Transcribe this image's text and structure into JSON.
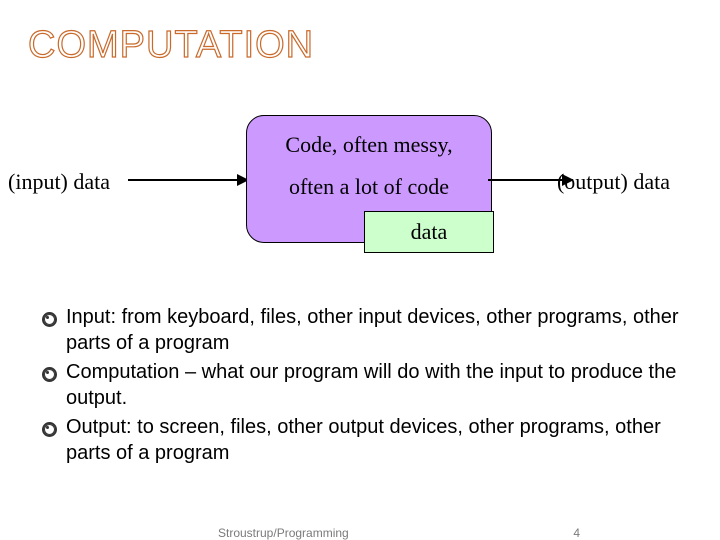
{
  "title": "COMPUTATION",
  "diagram": {
    "input_label": "(input) data",
    "output_label": "(output) data",
    "code_line1": "Code, often messy,",
    "code_line2": "often a lot of code",
    "data_box": "data"
  },
  "bullets": [
    "Input: from keyboard, files, other input devices, other programs, other parts of a program",
    "Computation – what our program will do with the input to produce the output.",
    "Output: to screen, files, other output devices, other programs, other parts of a program"
  ],
  "footer": {
    "credit": "Stroustrup/Programming",
    "page": "4"
  }
}
